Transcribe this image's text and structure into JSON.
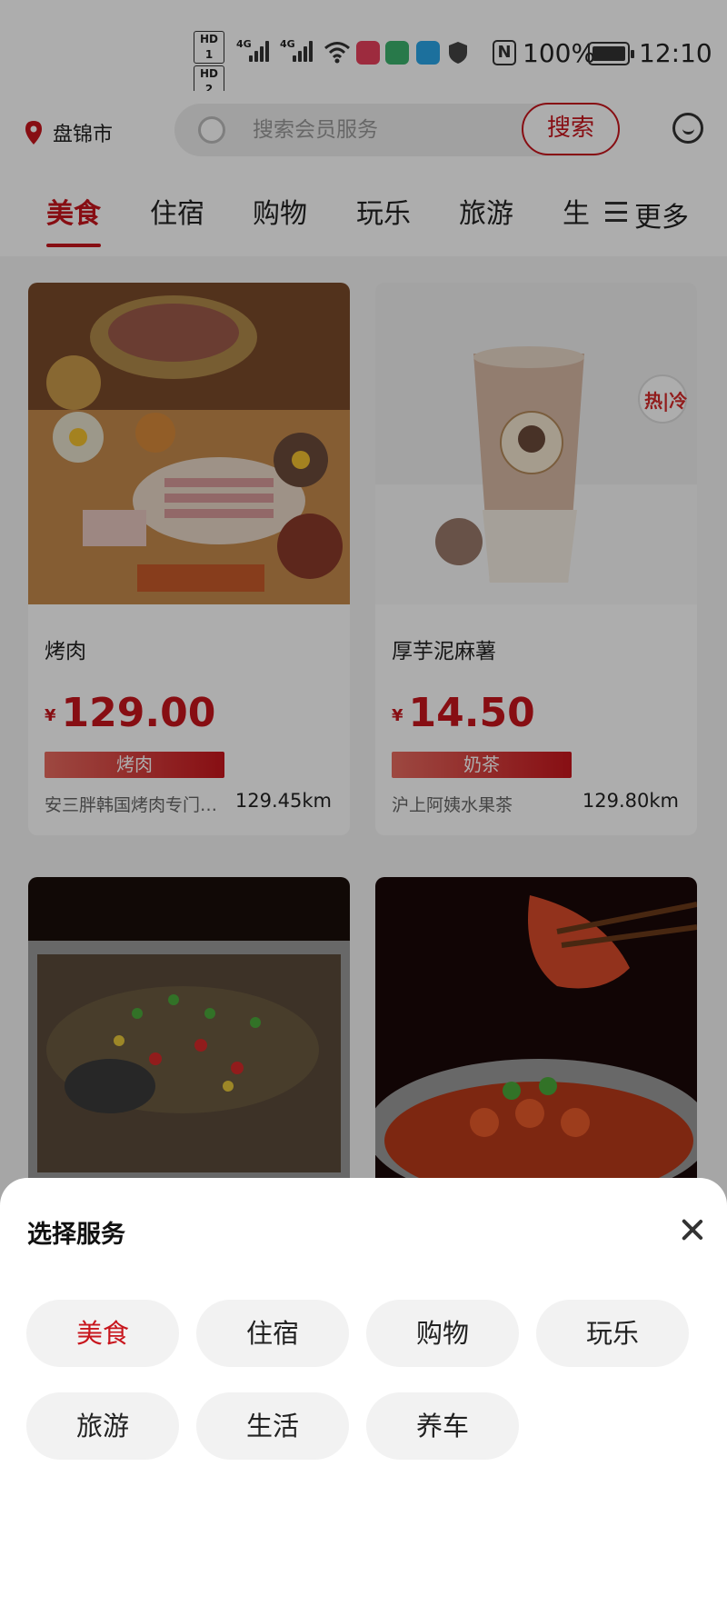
{
  "status_bar": {
    "hd1": "HD 1",
    "hd2": "HD 2",
    "net1": "4G",
    "net2": "4G",
    "battery": "100%",
    "time": "12:10"
  },
  "header": {
    "city": "盘锦市",
    "search_placeholder": "搜索会员服务",
    "search_button": "搜索"
  },
  "tabs": {
    "items": [
      "美食",
      "住宿",
      "购物",
      "玩乐",
      "旅游",
      "生"
    ],
    "active": "美食",
    "more_label": "更多"
  },
  "products": [
    {
      "title": "烤肉",
      "currency": "¥",
      "price": "129.00",
      "tag": "烤肉",
      "shop": "安三胖韩国烤肉专门…",
      "distance": "129.45km"
    },
    {
      "title": "厚芋泥麻薯",
      "currency": "¥",
      "price": "14.50",
      "tag": "奶茶",
      "shop": "沪上阿姨水果茶",
      "distance": "129.80km"
    },
    {
      "title": "",
      "currency": "",
      "price": "",
      "tag": "",
      "shop": "",
      "distance": ""
    },
    {
      "title": "",
      "currency": "",
      "price": "",
      "tag": "",
      "shop": "",
      "distance": ""
    }
  ],
  "cup_label": "热|冷",
  "sheet": {
    "title": "选择服务",
    "services": [
      "美食",
      "住宿",
      "购物",
      "玩乐",
      "旅游",
      "生活",
      "养车"
    ],
    "selected": "美食"
  },
  "colors": {
    "accent": "#c8161d",
    "background": "#f5f5f5",
    "chip_bg": "#f2f2f2"
  }
}
